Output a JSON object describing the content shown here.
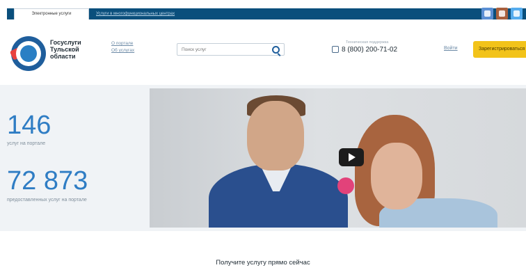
{
  "topbar": {
    "active_tab": "Электронные услуги",
    "link": "Услуги в многофункциональных центрах"
  },
  "header": {
    "brand": [
      "Госуслуги",
      "Тульской",
      "области"
    ],
    "links": [
      "О портале",
      "Об услугах"
    ],
    "search_placeholder": "Поиск услуг",
    "support_label": "Техническая поддержка",
    "phone": "8 (800) 200-71-02",
    "login": "Войти",
    "register": "Зарегистрироваться"
  },
  "stats": [
    {
      "value": "146",
      "label": "услуг на портале"
    },
    {
      "value": "72 873",
      "label": "предоставленных услуг на портале"
    }
  ],
  "caption": "Получите услугу прямо сейчас",
  "colors": {
    "accent": "#2f7dc4",
    "topbar": "#0a4f7c",
    "register": "#f2c31a"
  }
}
